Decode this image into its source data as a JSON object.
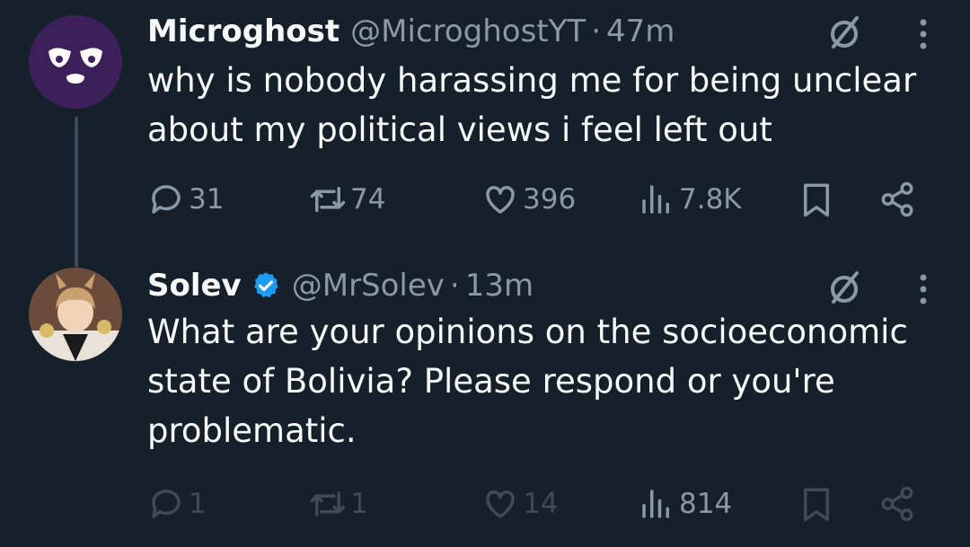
{
  "tweets": [
    {
      "author": {
        "name": "Microghost",
        "handle": "@MicroghostYT",
        "avatar_bg": "#3d1f5c"
      },
      "separator": "·",
      "time": "47m",
      "text": "why is nobody harassing me for being unclear\nabout my political views i feel left out",
      "stats": {
        "replies": "31",
        "retweets": "74",
        "likes": "396",
        "views": "7.8K"
      }
    },
    {
      "author": {
        "name": "Solev",
        "handle": "@MrSolev",
        "verified": true,
        "verified_color": "#1d9bf0",
        "avatar_bg": "#6b4b3a"
      },
      "separator": "·",
      "time": "13m",
      "text": "What are your opinions on the socioeconomic\nstate of Bolivia? Please respond or you're\nproblematic.",
      "stats": {
        "replies": "1",
        "retweets": "1",
        "likes": "14",
        "views": "814"
      }
    }
  ],
  "colors": {
    "background": "#15202b",
    "primary_text": "#f7f9f9",
    "secondary_text": "#8b98a5",
    "dim_icon": "#3e4a58",
    "thread_line": "#3b4a5a"
  },
  "icons": {
    "reply": "reply-icon",
    "retweet": "retweet-icon",
    "like": "heart-icon",
    "views": "views-icon",
    "bookmark": "bookmark-icon",
    "share": "share-icon",
    "grok": "grok-icon",
    "more": "more-dots-icon",
    "verified": "verified-badge-icon"
  }
}
